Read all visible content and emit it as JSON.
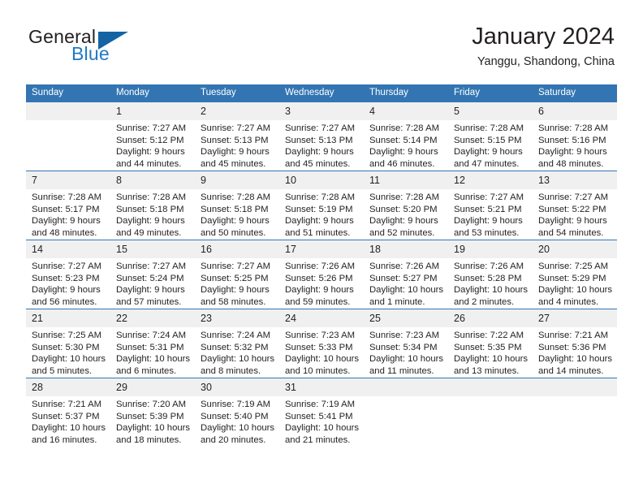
{
  "brand": {
    "name_part1": "General",
    "name_part2": "Blue",
    "triangle_color": "#1464a5",
    "blue_color": "#1f7ac4"
  },
  "header": {
    "title": "January 2024",
    "subtitle": "Yanggu, Shandong, China",
    "header_bg": "#3375b2",
    "daynum_bg": "#f0f0f0"
  },
  "weekday_headers": [
    "Sunday",
    "Monday",
    "Tuesday",
    "Wednesday",
    "Thursday",
    "Friday",
    "Saturday"
  ],
  "labels": {
    "sunrise_prefix": "Sunrise:",
    "sunset_prefix": "Sunset:",
    "daylight_prefix": "Daylight:"
  },
  "weeks": [
    [
      {
        "day": "",
        "blank": true
      },
      {
        "day": "1",
        "sunrise": "Sunrise: 7:27 AM",
        "sunset": "Sunset: 5:12 PM",
        "daylight_line1": "Daylight: 9 hours",
        "daylight_line2": "and 44 minutes."
      },
      {
        "day": "2",
        "sunrise": "Sunrise: 7:27 AM",
        "sunset": "Sunset: 5:13 PM",
        "daylight_line1": "Daylight: 9 hours",
        "daylight_line2": "and 45 minutes."
      },
      {
        "day": "3",
        "sunrise": "Sunrise: 7:27 AM",
        "sunset": "Sunset: 5:13 PM",
        "daylight_line1": "Daylight: 9 hours",
        "daylight_line2": "and 45 minutes."
      },
      {
        "day": "4",
        "sunrise": "Sunrise: 7:28 AM",
        "sunset": "Sunset: 5:14 PM",
        "daylight_line1": "Daylight: 9 hours",
        "daylight_line2": "and 46 minutes."
      },
      {
        "day": "5",
        "sunrise": "Sunrise: 7:28 AM",
        "sunset": "Sunset: 5:15 PM",
        "daylight_line1": "Daylight: 9 hours",
        "daylight_line2": "and 47 minutes."
      },
      {
        "day": "6",
        "sunrise": "Sunrise: 7:28 AM",
        "sunset": "Sunset: 5:16 PM",
        "daylight_line1": "Daylight: 9 hours",
        "daylight_line2": "and 48 minutes."
      }
    ],
    [
      {
        "day": "7",
        "sunrise": "Sunrise: 7:28 AM",
        "sunset": "Sunset: 5:17 PM",
        "daylight_line1": "Daylight: 9 hours",
        "daylight_line2": "and 48 minutes."
      },
      {
        "day": "8",
        "sunrise": "Sunrise: 7:28 AM",
        "sunset": "Sunset: 5:18 PM",
        "daylight_line1": "Daylight: 9 hours",
        "daylight_line2": "and 49 minutes."
      },
      {
        "day": "9",
        "sunrise": "Sunrise: 7:28 AM",
        "sunset": "Sunset: 5:18 PM",
        "daylight_line1": "Daylight: 9 hours",
        "daylight_line2": "and 50 minutes."
      },
      {
        "day": "10",
        "sunrise": "Sunrise: 7:28 AM",
        "sunset": "Sunset: 5:19 PM",
        "daylight_line1": "Daylight: 9 hours",
        "daylight_line2": "and 51 minutes."
      },
      {
        "day": "11",
        "sunrise": "Sunrise: 7:28 AM",
        "sunset": "Sunset: 5:20 PM",
        "daylight_line1": "Daylight: 9 hours",
        "daylight_line2": "and 52 minutes."
      },
      {
        "day": "12",
        "sunrise": "Sunrise: 7:27 AM",
        "sunset": "Sunset: 5:21 PM",
        "daylight_line1": "Daylight: 9 hours",
        "daylight_line2": "and 53 minutes."
      },
      {
        "day": "13",
        "sunrise": "Sunrise: 7:27 AM",
        "sunset": "Sunset: 5:22 PM",
        "daylight_line1": "Daylight: 9 hours",
        "daylight_line2": "and 54 minutes."
      }
    ],
    [
      {
        "day": "14",
        "sunrise": "Sunrise: 7:27 AM",
        "sunset": "Sunset: 5:23 PM",
        "daylight_line1": "Daylight: 9 hours",
        "daylight_line2": "and 56 minutes."
      },
      {
        "day": "15",
        "sunrise": "Sunrise: 7:27 AM",
        "sunset": "Sunset: 5:24 PM",
        "daylight_line1": "Daylight: 9 hours",
        "daylight_line2": "and 57 minutes."
      },
      {
        "day": "16",
        "sunrise": "Sunrise: 7:27 AM",
        "sunset": "Sunset: 5:25 PM",
        "daylight_line1": "Daylight: 9 hours",
        "daylight_line2": "and 58 minutes."
      },
      {
        "day": "17",
        "sunrise": "Sunrise: 7:26 AM",
        "sunset": "Sunset: 5:26 PM",
        "daylight_line1": "Daylight: 9 hours",
        "daylight_line2": "and 59 minutes."
      },
      {
        "day": "18",
        "sunrise": "Sunrise: 7:26 AM",
        "sunset": "Sunset: 5:27 PM",
        "daylight_line1": "Daylight: 10 hours",
        "daylight_line2": "and 1 minute."
      },
      {
        "day": "19",
        "sunrise": "Sunrise: 7:26 AM",
        "sunset": "Sunset: 5:28 PM",
        "daylight_line1": "Daylight: 10 hours",
        "daylight_line2": "and 2 minutes."
      },
      {
        "day": "20",
        "sunrise": "Sunrise: 7:25 AM",
        "sunset": "Sunset: 5:29 PM",
        "daylight_line1": "Daylight: 10 hours",
        "daylight_line2": "and 4 minutes."
      }
    ],
    [
      {
        "day": "21",
        "sunrise": "Sunrise: 7:25 AM",
        "sunset": "Sunset: 5:30 PM",
        "daylight_line1": "Daylight: 10 hours",
        "daylight_line2": "and 5 minutes."
      },
      {
        "day": "22",
        "sunrise": "Sunrise: 7:24 AM",
        "sunset": "Sunset: 5:31 PM",
        "daylight_line1": "Daylight: 10 hours",
        "daylight_line2": "and 6 minutes."
      },
      {
        "day": "23",
        "sunrise": "Sunrise: 7:24 AM",
        "sunset": "Sunset: 5:32 PM",
        "daylight_line1": "Daylight: 10 hours",
        "daylight_line2": "and 8 minutes."
      },
      {
        "day": "24",
        "sunrise": "Sunrise: 7:23 AM",
        "sunset": "Sunset: 5:33 PM",
        "daylight_line1": "Daylight: 10 hours",
        "daylight_line2": "and 10 minutes."
      },
      {
        "day": "25",
        "sunrise": "Sunrise: 7:23 AM",
        "sunset": "Sunset: 5:34 PM",
        "daylight_line1": "Daylight: 10 hours",
        "daylight_line2": "and 11 minutes."
      },
      {
        "day": "26",
        "sunrise": "Sunrise: 7:22 AM",
        "sunset": "Sunset: 5:35 PM",
        "daylight_line1": "Daylight: 10 hours",
        "daylight_line2": "and 13 minutes."
      },
      {
        "day": "27",
        "sunrise": "Sunrise: 7:21 AM",
        "sunset": "Sunset: 5:36 PM",
        "daylight_line1": "Daylight: 10 hours",
        "daylight_line2": "and 14 minutes."
      }
    ],
    [
      {
        "day": "28",
        "sunrise": "Sunrise: 7:21 AM",
        "sunset": "Sunset: 5:37 PM",
        "daylight_line1": "Daylight: 10 hours",
        "daylight_line2": "and 16 minutes."
      },
      {
        "day": "29",
        "sunrise": "Sunrise: 7:20 AM",
        "sunset": "Sunset: 5:39 PM",
        "daylight_line1": "Daylight: 10 hours",
        "daylight_line2": "and 18 minutes."
      },
      {
        "day": "30",
        "sunrise": "Sunrise: 7:19 AM",
        "sunset": "Sunset: 5:40 PM",
        "daylight_line1": "Daylight: 10 hours",
        "daylight_line2": "and 20 minutes."
      },
      {
        "day": "31",
        "sunrise": "Sunrise: 7:19 AM",
        "sunset": "Sunset: 5:41 PM",
        "daylight_line1": "Daylight: 10 hours",
        "daylight_line2": "and 21 minutes."
      },
      {
        "day": "",
        "blank": true
      },
      {
        "day": "",
        "blank": true
      },
      {
        "day": "",
        "blank": true
      }
    ]
  ]
}
